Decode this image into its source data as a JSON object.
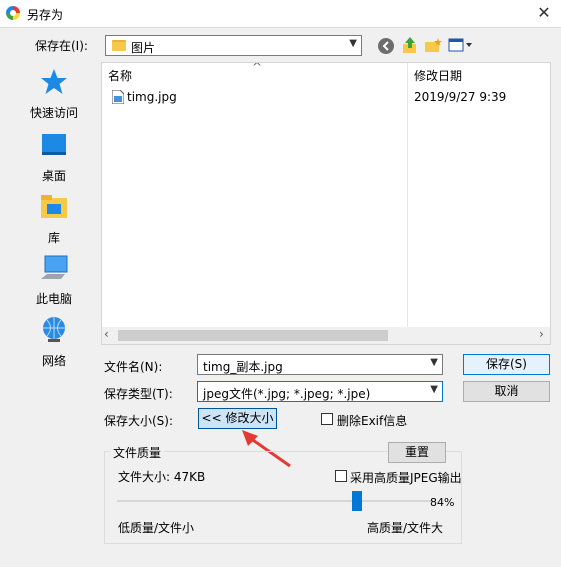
{
  "window": {
    "title": "另存为",
    "close": "✕"
  },
  "save_in": {
    "label": "保存在(I):",
    "value": "图片"
  },
  "places": [
    {
      "label": "快速访问",
      "icon": "star-icon"
    },
    {
      "label": "桌面",
      "icon": "desktop-icon"
    },
    {
      "label": "库",
      "icon": "library-icon"
    },
    {
      "label": "此电脑",
      "icon": "computer-icon"
    },
    {
      "label": "网络",
      "icon": "network-icon"
    }
  ],
  "file_list": {
    "columns": [
      "名称",
      "修改日期"
    ],
    "sort_indicator": "^",
    "rows": [
      {
        "name": "timg.jpg",
        "date": "2019/9/27 9:39"
      }
    ]
  },
  "form": {
    "filename_label": "文件名(N):",
    "filename_value": "timg_副本.jpg",
    "filetype_label": "保存类型(T):",
    "filetype_value": "jpeg文件(*.jpg; *.jpeg; *.jpe)",
    "size_label": "保存大小(S):",
    "modify_size_button": "<< 修改大小",
    "remove_exif_label": "删除Exif信息"
  },
  "buttons": {
    "save": "保存(S)",
    "cancel": "取消",
    "reset": "重置"
  },
  "quality": {
    "group_label": "文件质量",
    "file_size_text": "文件大小: 47KB",
    "hq_jpeg_label": "采用高质量JPEG输出",
    "percent_text": "84%",
    "level": 0.84,
    "low_label": "低质量/文件小",
    "high_label": "高质量/文件大"
  },
  "colors": {
    "accent": "#0078d7",
    "annotation_arrow": "#e53935"
  }
}
